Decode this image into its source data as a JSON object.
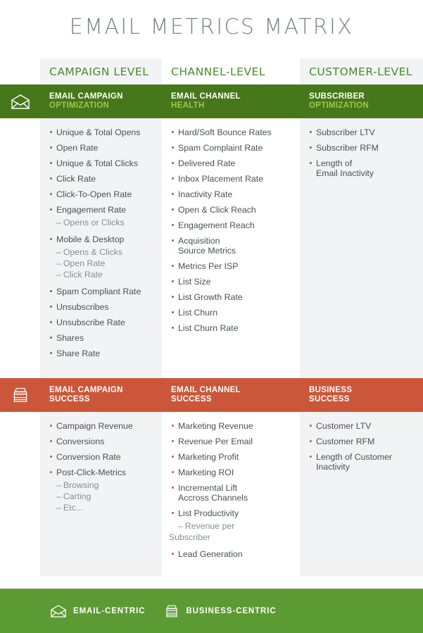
{
  "title": "EMAIL METRICS MATRIX",
  "colors": {
    "green_dark": "#46781B",
    "green_footer": "#5C9A33",
    "green_accent": "#4B8A2B",
    "green_light": "#9EC44E",
    "red": "#CC5639",
    "band_gray": "#F2F3F4",
    "title_gray": "#7D8186",
    "text_dark": "#4B4F54",
    "text_sub": "#8A8D91"
  },
  "column_headers": [
    {
      "label": "CAMPAIGN LEVEL"
    },
    {
      "label": "CHANNEL-LEVEL"
    },
    {
      "label": "CUSTOMER-LEVEL"
    }
  ],
  "sections": [
    {
      "id": "optimization",
      "icon": "envelope-icon",
      "banners": [
        {
          "line1": "EMAIL CAMPAIGN",
          "line2": "OPTIMIZATION"
        },
        {
          "line1": "EMAIL CHANNEL",
          "line2": "HEALTH"
        },
        {
          "line1": "SUBSCRIBER",
          "line2": "OPTIMIZATION"
        }
      ],
      "columns": [
        {
          "items": [
            {
              "text": "Unique & Total Opens"
            },
            {
              "text": "Open Rate"
            },
            {
              "text": "Unique & Total Clicks"
            },
            {
              "text": "Click Rate"
            },
            {
              "text": "Click-To-Open Rate"
            },
            {
              "text": "Engagement Rate",
              "subs": [
                "Opens or Clicks"
              ]
            },
            {
              "text": "Mobile & Desktop",
              "subs": [
                "Opens & Clicks",
                "Open Rate",
                "Click Rate"
              ]
            },
            {
              "text": "Spam Compliant Rate"
            },
            {
              "text": "Unsubscribes"
            },
            {
              "text": "Unsubscribe Rate"
            },
            {
              "text": "Shares"
            },
            {
              "text": "Share Rate"
            }
          ]
        },
        {
          "items": [
            {
              "text": "Hard/Soft Bounce Rates"
            },
            {
              "text": "Spam Complaint Rate"
            },
            {
              "text": "Delivered Rate"
            },
            {
              "text": "Inbox Placement Rate"
            },
            {
              "text": "Inactivity Rate"
            },
            {
              "text": "Open & Click Reach"
            },
            {
              "text": "Engagement Reach"
            },
            {
              "text": "Acquisition",
              "cont": "Source Metrics"
            },
            {
              "text": "Metrics Per ISP"
            },
            {
              "text": "List Size"
            },
            {
              "text": "List Growth Rate"
            },
            {
              "text": "List Churn"
            },
            {
              "text": "List Churn Rate"
            }
          ]
        },
        {
          "items": [
            {
              "text": "Subscriber LTV"
            },
            {
              "text": "Subscriber RFM"
            },
            {
              "text": "Length of",
              "cont": "Email Inactivity"
            }
          ]
        }
      ]
    },
    {
      "id": "success",
      "icon": "shop-icon",
      "banners": [
        {
          "line1": "EMAIL CAMPAIGN",
          "line2": "SUCCESS"
        },
        {
          "line1": "EMAIL CHANNEL",
          "line2": "SUCCESS"
        },
        {
          "line1": "BUSINESS",
          "line2": "SUCCESS"
        }
      ],
      "columns": [
        {
          "items": [
            {
              "text": "Campaign Revenue"
            },
            {
              "text": "Conversions"
            },
            {
              "text": "Conversion Rate"
            },
            {
              "text": "Post-Click-Metrics",
              "subs": [
                "Browsing",
                "Carting",
                "Etc..."
              ]
            }
          ]
        },
        {
          "items": [
            {
              "text": "Marketing Revenue"
            },
            {
              "text": "Revenue Per Email"
            },
            {
              "text": "Marketing Profit"
            },
            {
              "text": "Marketing ROI"
            },
            {
              "text": "Incremental Lift",
              "cont": "Accross Channels"
            },
            {
              "text": "List Productivity",
              "subs": [
                "Revenue per"
              ],
              "sub_overflow": "Subscriber"
            },
            {
              "text": "Lead Generation"
            }
          ]
        },
        {
          "items": [
            {
              "text": "Customer LTV"
            },
            {
              "text": "Customer RFM"
            },
            {
              "text": "Length of  Customer",
              "cont": "Inactivity"
            }
          ]
        }
      ]
    }
  ],
  "footer": {
    "legends": [
      {
        "icon": "envelope-icon",
        "label": "EMAIL-CENTRIC"
      },
      {
        "icon": "shop-icon",
        "label": "BUSINESS-CENTRIC"
      }
    ]
  }
}
